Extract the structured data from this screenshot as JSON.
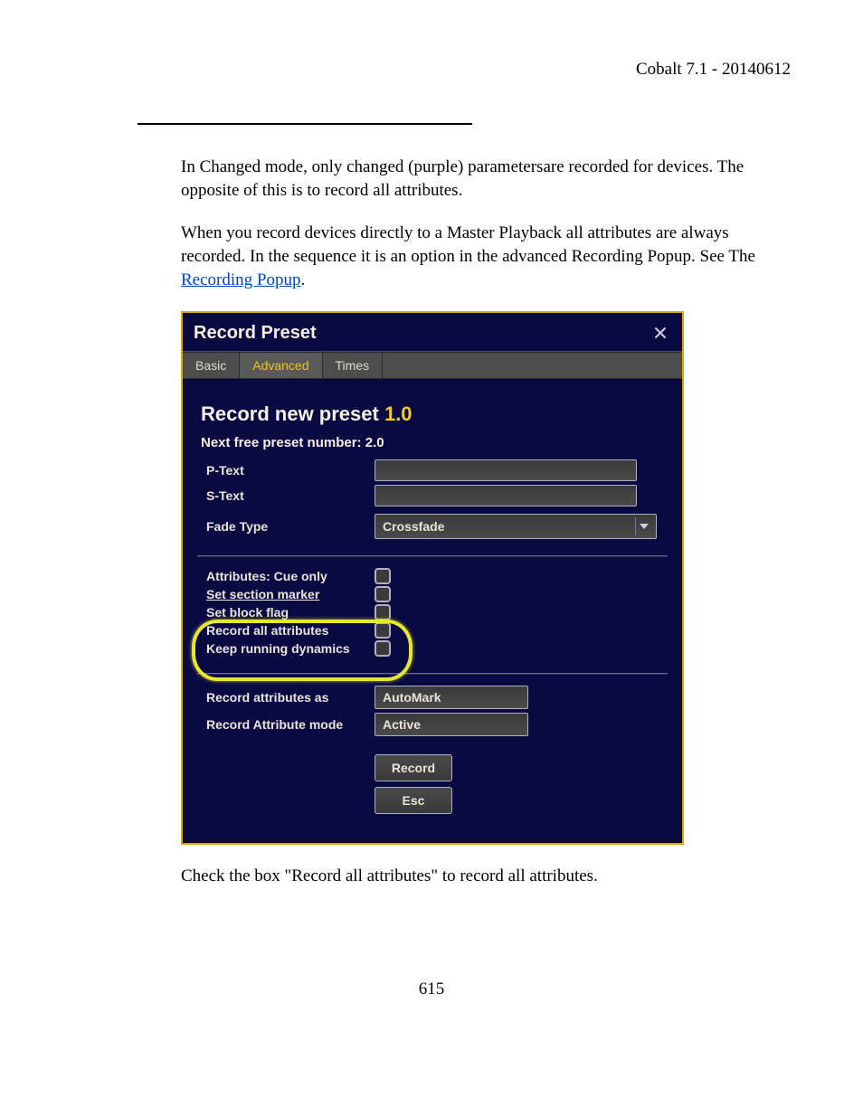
{
  "header": {
    "version": "Cobalt 7.1 - 20140612"
  },
  "paragraphs": {
    "p1": "In Changed mode, only changed (purple) parametersare recorded for devices. The opposite of this is to record all attributes.",
    "p2a": "When you record devices directly to a Master Playback all attributes are always recorded. In the sequence it is an option in the advanced Recording Popup. See The ",
    "p2_link": "Recording Popup",
    "p2b": ".",
    "p3": "Check the box \"Record all attributes\" to record all attributes."
  },
  "dialog": {
    "title": "Record Preset",
    "tabs": {
      "basic": "Basic",
      "advanced": "Advanced",
      "times": "Times"
    },
    "heading_prefix": "Record new preset ",
    "heading_number": "1.0",
    "next_free_label": "Next free preset number: ",
    "next_free_value": "2.0",
    "labels": {
      "ptext": "P-Text",
      "stext": "S-Text",
      "fadetype": "Fade Type",
      "attrs_cue_only": "Attributes: Cue only",
      "set_section_marker": "Set section marker",
      "set_block_flag": "Set block flag",
      "record_all_attributes": "Record all attributes",
      "keep_running_dynamics": "Keep running dynamics",
      "record_attrs_as": "Record attributes as",
      "record_attr_mode": "Record Attribute mode"
    },
    "values": {
      "fadetype": "Crossfade",
      "record_attrs_as": "AutoMark",
      "record_attr_mode": "Active"
    },
    "buttons": {
      "record": "Record",
      "esc": "Esc"
    }
  },
  "page_number": "615"
}
